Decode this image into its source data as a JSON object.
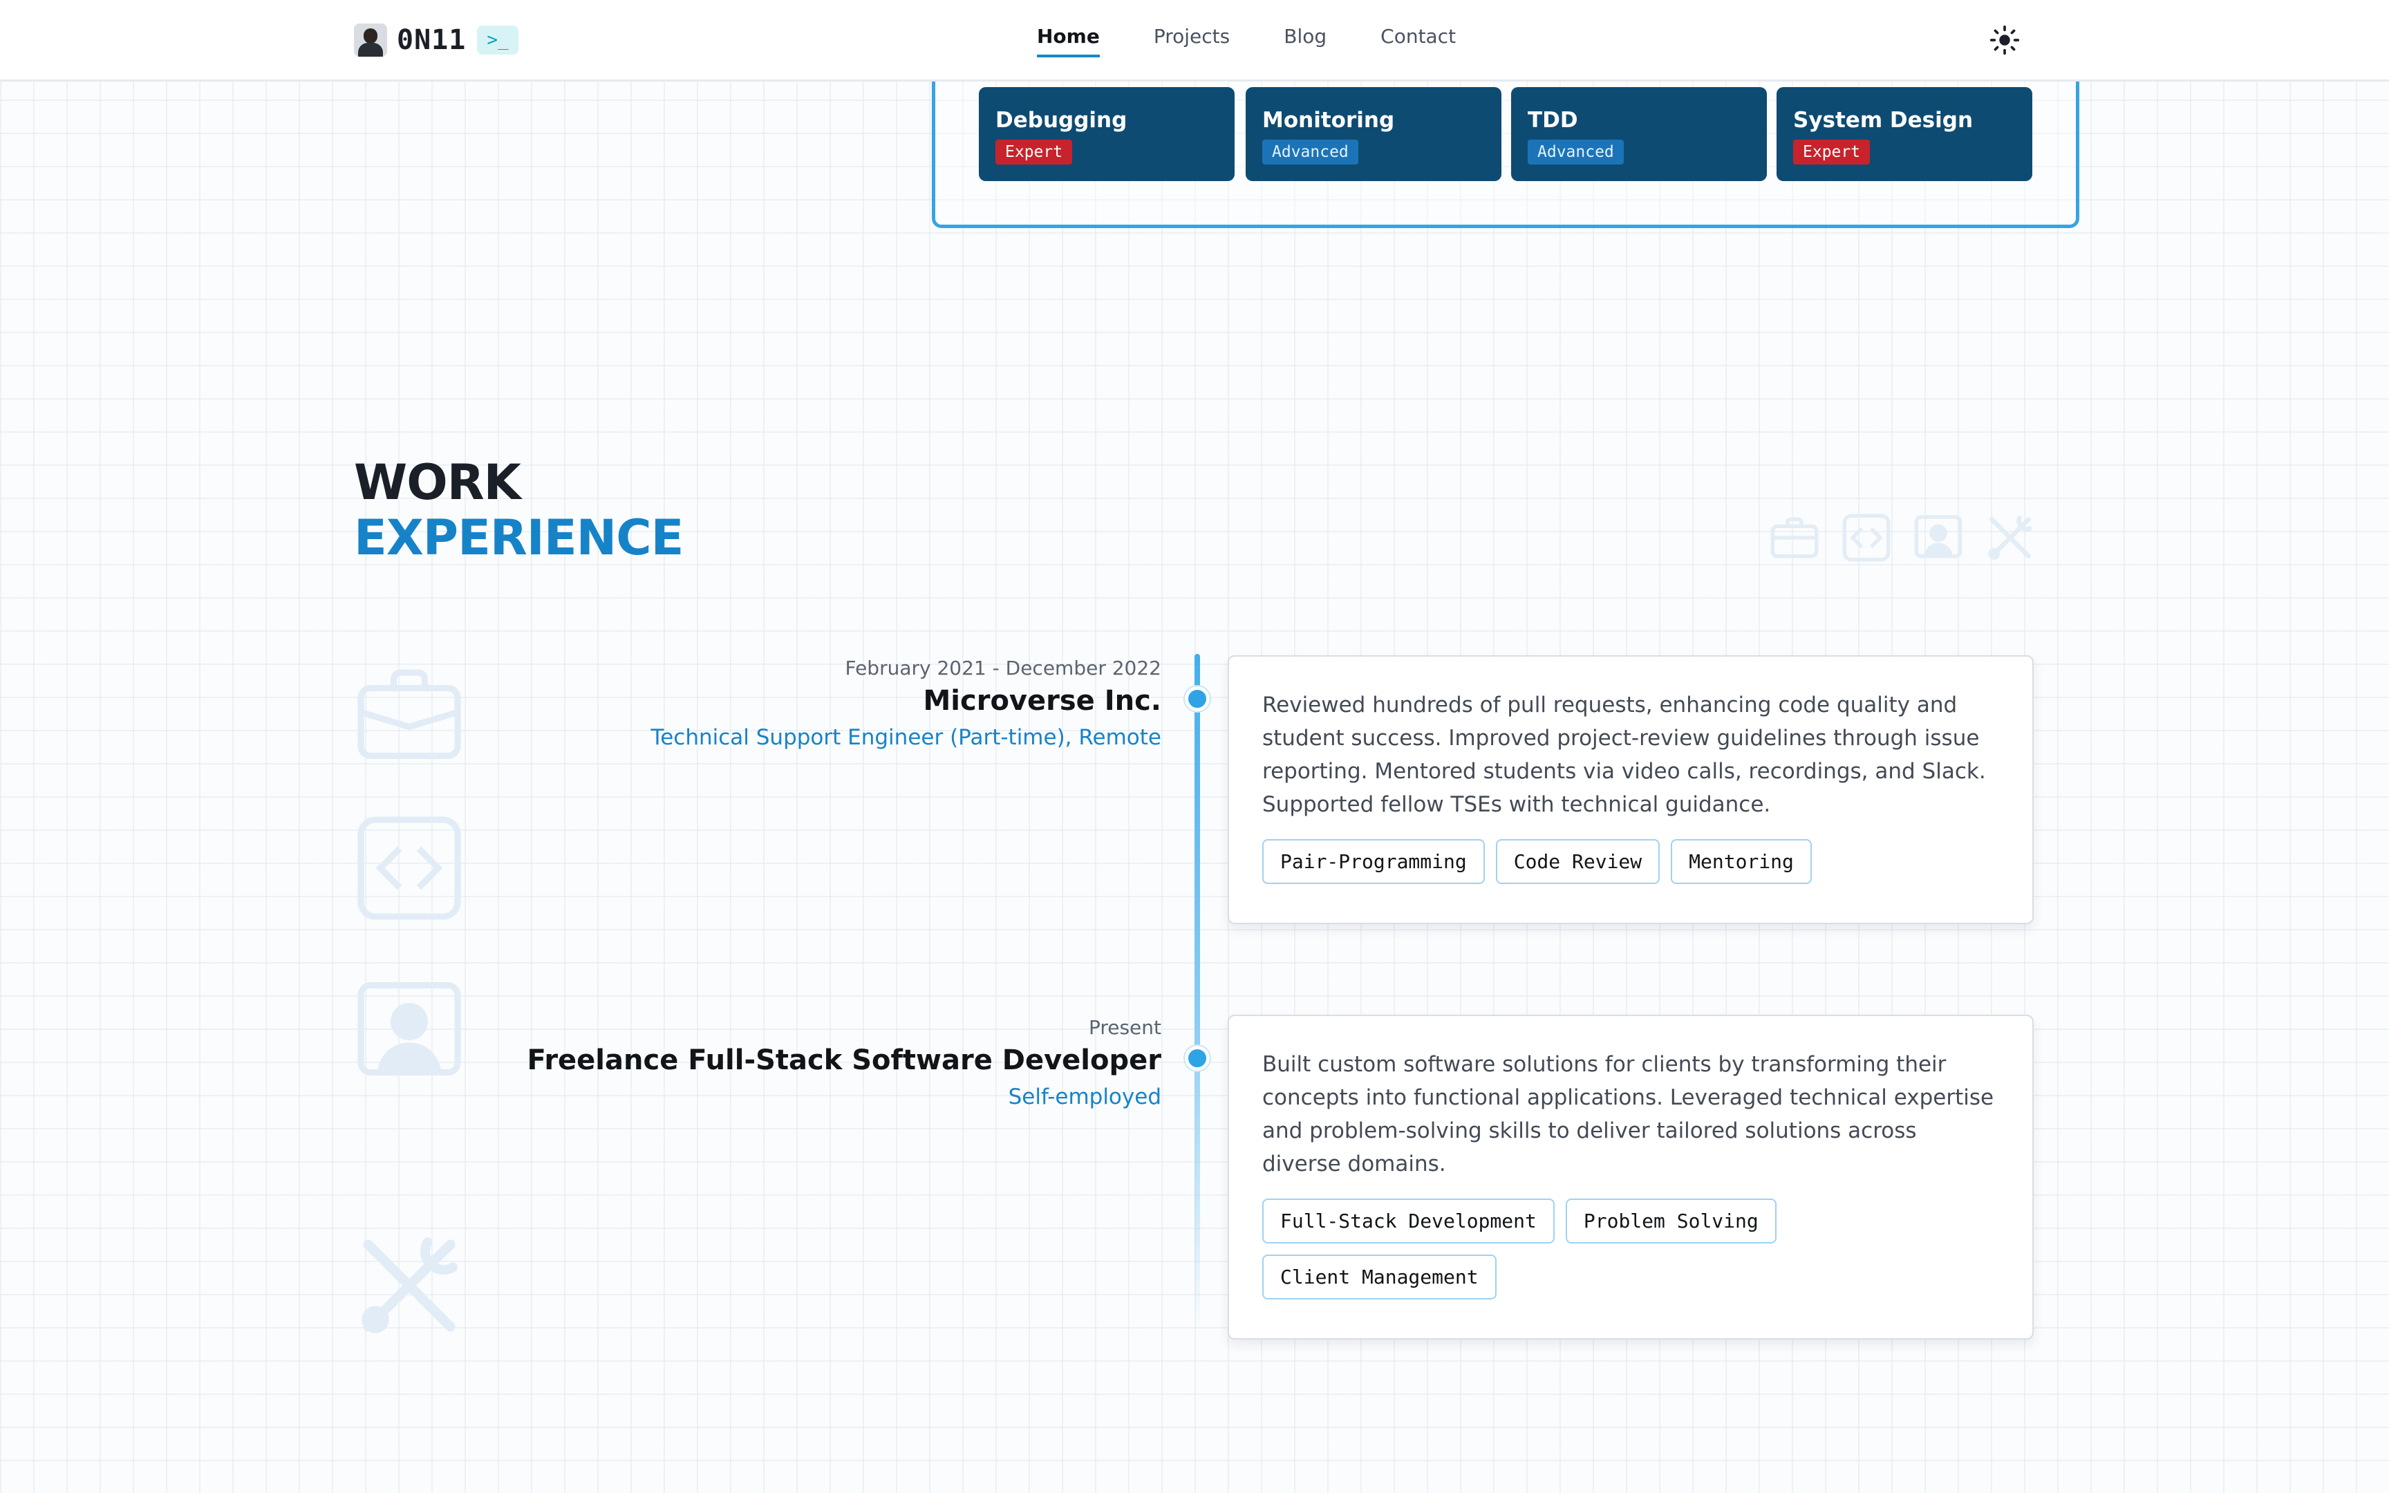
{
  "brand": {
    "name": "0N11",
    "prompt": ">_"
  },
  "nav": {
    "links": [
      {
        "label": "Home",
        "active": true
      },
      {
        "label": "Projects",
        "active": false
      },
      {
        "label": "Blog",
        "active": false
      },
      {
        "label": "Contact",
        "active": false
      }
    ],
    "theme_icon": "sun-icon"
  },
  "skills": [
    {
      "name": "Debugging",
      "level": "Expert"
    },
    {
      "name": "Monitoring",
      "level": "Advanced"
    },
    {
      "name": "TDD",
      "level": "Advanced"
    },
    {
      "name": "System Design",
      "level": "Expert"
    }
  ],
  "section": {
    "title_line_1": "WORK",
    "title_line_2": "EXPERIENCE",
    "deco_icons": [
      "briefcase-icon",
      "code-icon",
      "user-icon",
      "tools-icon"
    ]
  },
  "experience": [
    {
      "date": "February 2021 - December 2022",
      "company": "Microverse Inc.",
      "role": "Technical Support Engineer (Part-time), Remote",
      "description": "Reviewed hundreds of pull requests, enhancing code quality and student success. Improved project-review guidelines through issue reporting. Mentored students via video calls, recordings, and Slack. Supported fellow TSEs with technical guidance.",
      "tags": [
        "Pair-Programming",
        "Code Review",
        "Mentoring"
      ]
    },
    {
      "date": "Present",
      "company": "Freelance Full-Stack Software Developer",
      "role": "Self-employed",
      "description": "Built custom software solutions for clients by transforming their concepts into functional applications. Leveraged technical expertise and problem-solving skills to deliver tailored solutions across diverse domains.",
      "tags": [
        "Full-Stack Development",
        "Problem Solving",
        "Client Management"
      ]
    }
  ],
  "colors": {
    "accent": "#1683c9",
    "skill_card": "#0e4b73",
    "expert": "#c8232c",
    "advanced": "#1b74b8",
    "timeline": "#2ea3e6",
    "tag_border": "#9fd2f2"
  }
}
